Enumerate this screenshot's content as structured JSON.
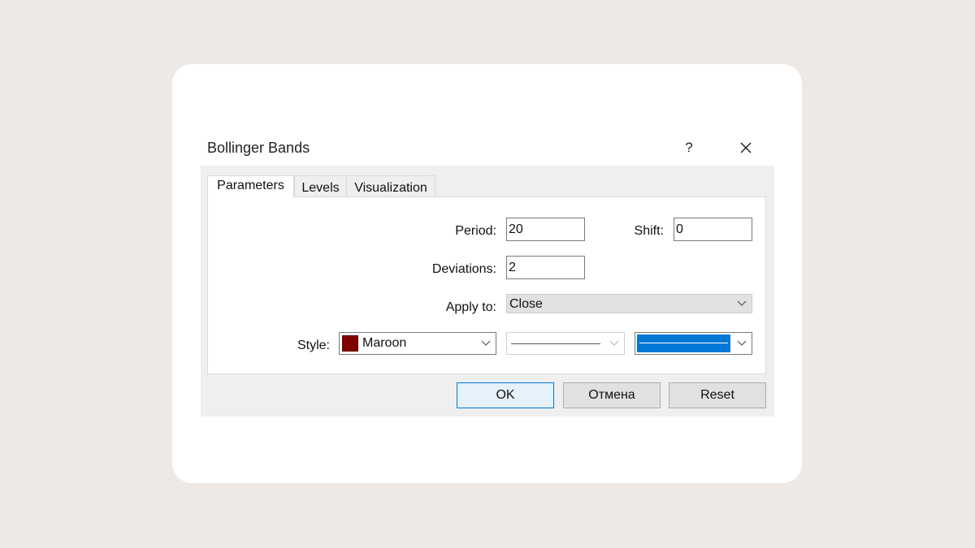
{
  "dialog": {
    "title": "Bollinger Bands",
    "help_label": "?"
  },
  "tabs": [
    {
      "label": "Parameters",
      "active": true
    },
    {
      "label": "Levels",
      "active": false
    },
    {
      "label": "Visualization",
      "active": false
    }
  ],
  "parameters": {
    "period_label": "Period:",
    "period_value": "20",
    "shift_label": "Shift:",
    "shift_value": "0",
    "deviations_label": "Deviations:",
    "deviations_value": "2",
    "apply_to_label": "Apply to:",
    "apply_to_value": "Close",
    "style_label": "Style:",
    "color_value": "Maroon",
    "color_hex": "#800000",
    "line_style": "solid",
    "line_width_color": "#0078d7"
  },
  "buttons": {
    "ok": "OK",
    "cancel": "Отмена",
    "reset": "Reset"
  }
}
